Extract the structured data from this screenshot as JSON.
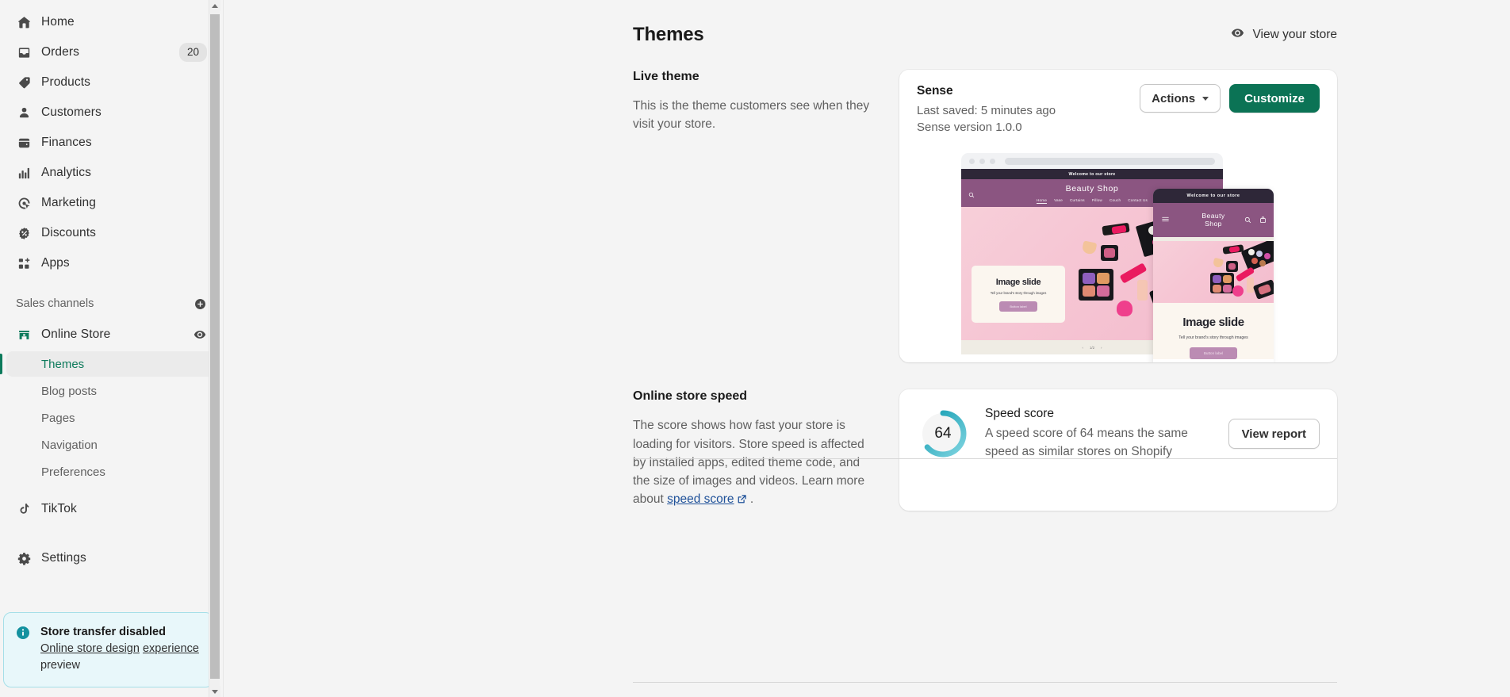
{
  "colors": {
    "brand_green": "#0b7355",
    "accent_green": "#0c7a5b",
    "link_blue": "#1f5199",
    "info_teal": "#13919f",
    "score_teal": "#3fb5c4",
    "store_purple": "#8b5581",
    "store_dark": "#2e2738"
  },
  "sidebar": {
    "main_items": [
      {
        "label": "Home",
        "icon": "home-icon",
        "badge": null
      },
      {
        "label": "Orders",
        "icon": "orders-inbox-icon",
        "badge": "20"
      },
      {
        "label": "Products",
        "icon": "products-tag-icon",
        "badge": null
      },
      {
        "label": "Customers",
        "icon": "customers-person-icon",
        "badge": null
      },
      {
        "label": "Finances",
        "icon": "finances-wallet-icon",
        "badge": null
      },
      {
        "label": "Analytics",
        "icon": "analytics-bars-icon",
        "badge": null
      },
      {
        "label": "Marketing",
        "icon": "marketing-target-icon",
        "badge": null
      },
      {
        "label": "Discounts",
        "icon": "discounts-percent-icon",
        "badge": null
      },
      {
        "label": "Apps",
        "icon": "apps-grid-icon",
        "badge": null
      }
    ],
    "sales_channels": {
      "title": "Sales channels",
      "add_icon": "plus-circle-icon",
      "online_store": {
        "label": "Online Store",
        "icon": "storefront-icon",
        "preview_icon": "eye-icon"
      },
      "sub_items": [
        {
          "label": "Themes",
          "active": true
        },
        {
          "label": "Blog posts",
          "active": false
        },
        {
          "label": "Pages",
          "active": false
        },
        {
          "label": "Navigation",
          "active": false
        },
        {
          "label": "Preferences",
          "active": false
        }
      ]
    },
    "tiktok": {
      "label": "TikTok",
      "icon": "tiktok-icon"
    },
    "settings": {
      "label": "Settings",
      "icon": "gear-icon"
    },
    "info_banner": {
      "icon": "info-circle-icon",
      "title": "Store transfer disabled",
      "link_text": "Online store design",
      "link_text_2": "experience",
      "tail_text": " preview"
    }
  },
  "header": {
    "title": "Themes",
    "view_store": {
      "label": "View your store",
      "icon": "eye-icon"
    }
  },
  "live_theme": {
    "heading": "Live theme",
    "description": "This is the theme customers see when they visit your store.",
    "theme_name": "Sense",
    "last_saved": "Last saved: 5 minutes ago",
    "version": "Sense version 1.0.0",
    "actions_label": "Actions",
    "customize_label": "Customize"
  },
  "preview": {
    "announcement": "Welcome to our store",
    "store_name": "Beauty Shop",
    "store_name_line1": "Beauty",
    "store_name_line2": "Shop",
    "nav": [
      "Home",
      "Vase",
      "Curtains",
      "Pillow",
      "Couch",
      "Contact Us"
    ],
    "slide_title": "Image slide",
    "slide_sub": "Tell your brand's story through images",
    "slide_button": "Button label",
    "carousel_indicator": "1/2",
    "icons": [
      "search-icon",
      "account-icon",
      "cart-icon",
      "hamburger-icon"
    ]
  },
  "store_speed": {
    "heading": "Online store speed",
    "description_part1": "The score shows how fast your store is loading for visitors. Store speed is affected by installed apps, edited theme code, and the size of images and videos. Learn more about ",
    "link_text": "speed score",
    "description_part2": " .",
    "score": "64",
    "score_title": "Speed score",
    "score_desc": "A speed score of 64 means the same speed as similar stores on Shopify",
    "view_report_label": "View report"
  }
}
